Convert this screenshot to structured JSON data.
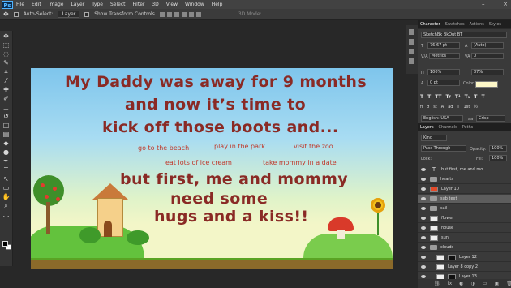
{
  "app": {
    "logo": "Ps"
  },
  "menu": [
    "File",
    "Edit",
    "Image",
    "Layer",
    "Type",
    "Select",
    "Filter",
    "3D",
    "View",
    "Window",
    "Help"
  ],
  "window_controls": [
    "–",
    "□",
    "×"
  ],
  "options_bar": {
    "auto_select_label": "Auto-Select:",
    "auto_select_value": "Layer",
    "show_transform_label": "Show Transform Controls",
    "mode_label": "3D Mode:"
  },
  "canvas_texts": {
    "line1": "My Daddy was away for 9 months",
    "line2": "and now it’s time to",
    "line3": "kick off those boots and...",
    "a1": "go to the beach",
    "a2": "play in the park",
    "a3": "visit the zoo",
    "a4": "eat lots of ice cream",
    "a5": "take mommy in a date",
    "line4": "but first, me and mommy",
    "line5": "need some",
    "line6": "hugs and a kiss!!"
  },
  "character_panel": {
    "tabs": [
      "Character",
      "Swatches",
      "Actions",
      "Styles"
    ],
    "font": "SketchBk BkOut BT",
    "size": "76.67 pt",
    "leading": "(Auto)",
    "kerning": "Metrics",
    "tracking": "0",
    "vscale": "100%",
    "hscale": "87%",
    "baseline": "0 pt",
    "color_label": "Color:",
    "language": "English: USA",
    "aa": "Crisp",
    "type_row": [
      "T",
      "T",
      "TT",
      "Tr",
      "T¹",
      "T₁",
      "T",
      "T"
    ],
    "ot_row": [
      "fi",
      "ơ",
      "st",
      "A",
      "ad",
      "T",
      "1st",
      "½"
    ]
  },
  "layers_panel": {
    "tabs": [
      "Layers",
      "Channels",
      "Paths"
    ],
    "kind": "Kind",
    "blend": "Pass Through",
    "opacity_label": "Opacity:",
    "opacity": "100%",
    "lock_label": "Lock:",
    "fill_label": "Fill:",
    "fill": "100%",
    "layers": [
      {
        "name": "but first, me and mo...",
        "type": "text"
      },
      {
        "name": "hearts",
        "type": "folder"
      },
      {
        "name": "Layer 10",
        "type": "pixel"
      },
      {
        "name": "sub text",
        "type": "folder"
      },
      {
        "name": "sail",
        "type": "folder"
      },
      {
        "name": "flower",
        "type": "pixel"
      },
      {
        "name": "house",
        "type": "pixel"
      },
      {
        "name": "sun",
        "type": "pixel"
      },
      {
        "name": "clouds",
        "type": "folder"
      },
      {
        "name": "Layer 12",
        "type": "pixel"
      },
      {
        "name": "Layer 8 copy 2",
        "type": "pixel"
      },
      {
        "name": "Layer 13",
        "type": "pixel"
      }
    ],
    "bottom_icons": [
      "⛓",
      "fx",
      "◐",
      "◑",
      "▭",
      "▣",
      "🗑"
    ]
  }
}
